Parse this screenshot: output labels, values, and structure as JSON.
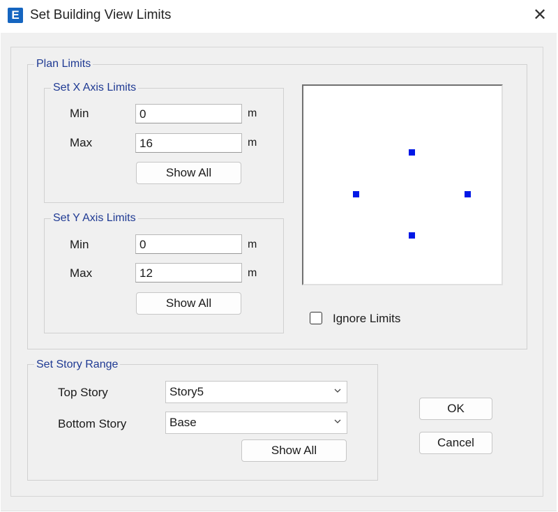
{
  "window": {
    "title": "Set Building View Limits",
    "app_icon_letter": "E",
    "close_glyph": "✕"
  },
  "plan_limits": {
    "legend": "Plan Limits",
    "x_axis": {
      "legend": "Set X Axis Limits",
      "min_label": "Min",
      "min_value": "0",
      "max_label": "Max",
      "max_value": "16",
      "unit": "m",
      "show_all_label": "Show All"
    },
    "y_axis": {
      "legend": "Set Y Axis Limits",
      "min_label": "Min",
      "min_value": "0",
      "max_label": "Max",
      "max_value": "12",
      "unit": "m",
      "show_all_label": "Show All"
    },
    "ignore_limits_label": "Ignore Limits",
    "ignore_limits_checked": false,
    "marker_color": "#0018e6"
  },
  "story_range": {
    "legend": "Set Story Range",
    "top_story_label": "Top Story",
    "top_story_value": "Story5",
    "bottom_story_label": "Bottom Story",
    "bottom_story_value": "Base",
    "show_all_label": "Show All"
  },
  "buttons": {
    "ok_label": "OK",
    "cancel_label": "Cancel"
  }
}
